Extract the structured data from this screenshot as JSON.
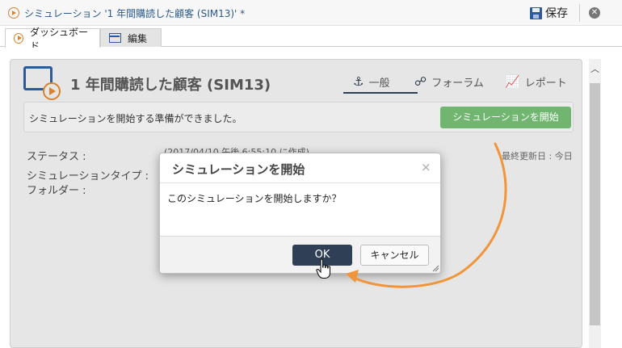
{
  "window": {
    "title": "シミュレーション '1 年間購読した顧客 (SIM13)' *",
    "save_label": "保存",
    "close_symbol": "✕"
  },
  "tabs": [
    {
      "label": "ダッシュボード",
      "icon": "play-circle-icon",
      "active": true
    },
    {
      "label": "編集",
      "icon": "edit-window-icon",
      "active": false
    }
  ],
  "header": {
    "title": "1 年間購読した顧客 (SIM13)",
    "view_tabs": [
      {
        "label": "一般",
        "icon": "anchor-icon",
        "glyph": "⚓",
        "active": true
      },
      {
        "label": "フォーラム",
        "icon": "forum-icon",
        "glyph": "☍",
        "active": false
      },
      {
        "label": "レポート",
        "icon": "chart-icon",
        "glyph": "📈",
        "active": false
      }
    ]
  },
  "ready_bar": {
    "message": "シミュレーションを開始する準備ができました。",
    "start_button": "シミュレーションを開始"
  },
  "details": {
    "status_label": "ステータス :",
    "status_value": "(2017/04/10 午後 6:55:10 に作成)",
    "type_label": "シミュレーションタイプ :",
    "folder_label": "フォルダー :",
    "last_updated": "最終更新日 : 今日"
  },
  "dialog": {
    "title": "シミュレーションを開始",
    "close_symbol": "×",
    "message": "このシミュレーションを開始しますか？",
    "ok_label": "OK",
    "cancel_label": "キャンセル"
  },
  "colors": {
    "accent_orange": "#f0953c",
    "start_green": "#70b670",
    "ok_dark": "#2f3f55",
    "brand_blue": "#2d5a9c"
  }
}
